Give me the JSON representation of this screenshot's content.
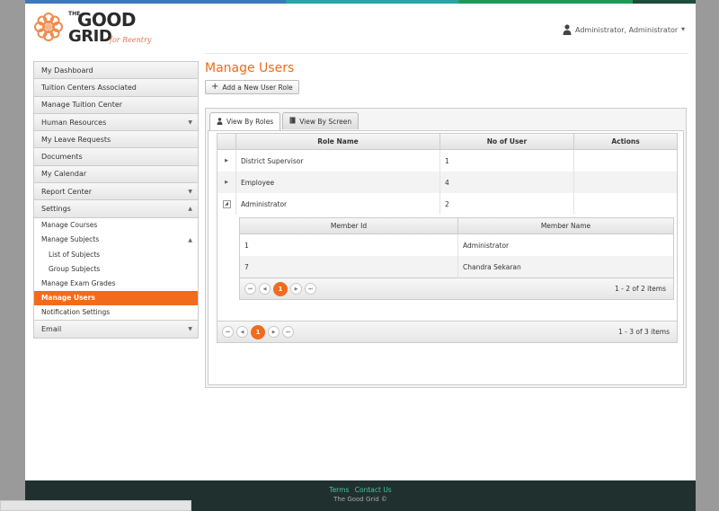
{
  "colors": {
    "accent": "#f26b1d",
    "topbar": [
      "#3b79bd",
      "#2aa3a8",
      "#1f9a56",
      "#1d4c3a"
    ],
    "footer_bg": "#20302e",
    "footer_link": "#4ac39a"
  },
  "logo": {
    "the": "THE",
    "good": "GOOD",
    "grid": "GRID",
    "sub": "for Reentry"
  },
  "user": {
    "icon": "user-icon",
    "label": "Administrator, Administrator"
  },
  "sidebar": {
    "items": [
      {
        "label": "My Dashboard"
      },
      {
        "label": "Tuition Centers Associated"
      },
      {
        "label": "Manage Tuition Center"
      },
      {
        "label": "Human Resources",
        "caret": "▼"
      },
      {
        "label": "My Leave Requests"
      },
      {
        "label": "Documents"
      },
      {
        "label": "My Calendar"
      },
      {
        "label": "Report Center",
        "caret": "▼"
      },
      {
        "label": "Settings",
        "caret": "▲"
      }
    ],
    "settings_sub": [
      {
        "label": "Manage Courses"
      },
      {
        "label": "Manage Subjects",
        "caret": "▲"
      },
      {
        "label": "List of Subjects"
      },
      {
        "label": "Group Subjects"
      },
      {
        "label": "Manage Exam Grades"
      },
      {
        "label": "Manage Users"
      },
      {
        "label": "Notification Settings"
      }
    ],
    "email": {
      "label": "Email",
      "caret": "▼"
    }
  },
  "main": {
    "title": "Manage Users",
    "add_button": "Add a New User Role",
    "add_icon": "plus-icon",
    "tabs": [
      {
        "label": "View By Roles",
        "icon": "user-icon"
      },
      {
        "label": "View By Screen",
        "icon": "book-icon"
      }
    ]
  },
  "grid": {
    "columns": [
      "Role Name",
      "No of User",
      "Actions"
    ],
    "rows": [
      {
        "role": "District Supervisor",
        "count": "1",
        "expander": "▶"
      },
      {
        "role": "Employee",
        "count": "4",
        "expander": "▶"
      },
      {
        "role": "Administrator",
        "count": "2",
        "expander": "◢"
      }
    ],
    "detail": {
      "columns": [
        "Member Id",
        "Member Name"
      ],
      "rows": [
        {
          "id": "1",
          "name": "Administrator"
        },
        {
          "id": "7",
          "name": "Chandra Sekaran"
        }
      ],
      "pager": {
        "page": "1",
        "info": "1 - 2 of 2 items"
      }
    },
    "pager": {
      "page": "1",
      "info": "1 - 3 of 3 items"
    },
    "pager_icons": {
      "first": "⏮",
      "prev": "◀",
      "next": "▶",
      "last": "⏭"
    }
  },
  "footer": {
    "terms": "Terms",
    "contact": "Contact Us",
    "copyright": "The Good Grid ©"
  }
}
